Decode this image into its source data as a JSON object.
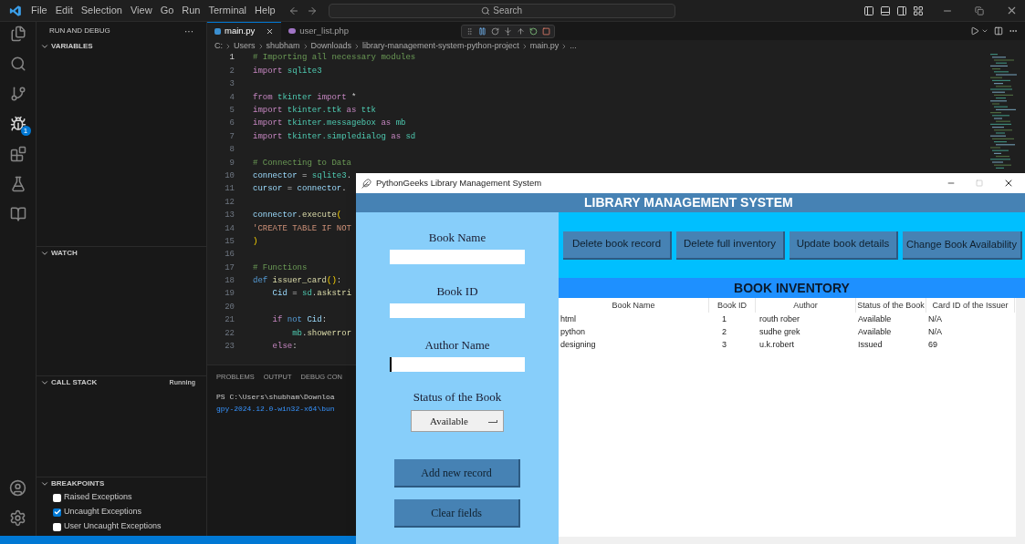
{
  "titlebar": {
    "menu": [
      "File",
      "Edit",
      "Selection",
      "View",
      "Go",
      "Run",
      "Terminal",
      "Help"
    ],
    "search": {
      "placeholder": "Search"
    }
  },
  "activity_bar": {
    "debug_badge": "1"
  },
  "sidebar": {
    "title": "RUN AND DEBUG",
    "more": "···",
    "sections": [
      {
        "title": "VARIABLES"
      },
      {
        "title": "WATCH"
      },
      {
        "title": "CALL STACK",
        "status": "Running"
      },
      {
        "title": "BREAKPOINTS",
        "items": [
          {
            "label": "Raised Exceptions",
            "checked": false
          },
          {
            "label": "Uncaught Exceptions",
            "checked": true
          },
          {
            "label": "User Uncaught Exceptions",
            "checked": false
          }
        ]
      }
    ]
  },
  "editor": {
    "tabs": [
      {
        "label": "main.py",
        "kind": "python",
        "selected": true
      },
      {
        "label": "user_list.php",
        "kind": "php",
        "selected": false
      }
    ],
    "breadcrumb": [
      "C:",
      "Users",
      "shubham",
      "Downloads",
      "library-management-system-python-project",
      "main.py",
      "..."
    ],
    "lines": [
      {
        "number": "1",
        "tokens": [
          {
            "kind": "comment",
            "text": "# Importing all necessary modules"
          }
        ]
      },
      {
        "number": "2",
        "tokens": [
          {
            "kind": "keyword",
            "text": "import"
          },
          {
            "kind": "module",
            "text": " sqlite3"
          }
        ]
      },
      {
        "number": "3"
      },
      {
        "number": "4",
        "tokens": [
          {
            "kind": "keyword",
            "text": "from"
          },
          {
            "kind": "module",
            "text": " tkinter"
          },
          {
            "kind": "keyword",
            "text": " import"
          },
          {
            "kind": "plain",
            "text": " *"
          }
        ]
      },
      {
        "number": "5",
        "tokens": [
          {
            "kind": "keyword",
            "text": "import"
          },
          {
            "kind": "module",
            "text": " tkinter.ttk"
          },
          {
            "kind": "keyword",
            "text": " as"
          },
          {
            "kind": "module",
            "text": " ttk"
          }
        ]
      },
      {
        "number": "6",
        "tokens": [
          {
            "kind": "keyword",
            "text": "import"
          },
          {
            "kind": "module",
            "text": " tkinter.messagebox"
          },
          {
            "kind": "keyword",
            "text": " as"
          },
          {
            "kind": "module",
            "text": " mb"
          }
        ]
      },
      {
        "number": "7",
        "tokens": [
          {
            "kind": "keyword",
            "text": "import"
          },
          {
            "kind": "module",
            "text": " tkinter.simpledialog"
          },
          {
            "kind": "keyword",
            "text": " as"
          },
          {
            "kind": "module",
            "text": " sd"
          }
        ]
      },
      {
        "number": "8"
      },
      {
        "number": "9",
        "tokens": [
          {
            "kind": "comment",
            "text": "# Connecting to Data"
          }
        ]
      },
      {
        "number": "10",
        "tokens": [
          {
            "kind": "variable",
            "text": "connector"
          },
          {
            "kind": "plain",
            "text": " = "
          },
          {
            "kind": "module",
            "text": "sqlite3"
          },
          {
            "kind": "plain",
            "text": "."
          }
        ]
      },
      {
        "number": "11",
        "tokens": [
          {
            "kind": "variable",
            "text": "cursor"
          },
          {
            "kind": "plain",
            "text": " = "
          },
          {
            "kind": "variable",
            "text": "connector"
          },
          {
            "kind": "plain",
            "text": "."
          }
        ]
      },
      {
        "number": "12"
      },
      {
        "number": "13",
        "tokens": [
          {
            "kind": "variable",
            "text": "connector"
          },
          {
            "kind": "plain",
            "text": "."
          },
          {
            "kind": "function",
            "text": "execute"
          },
          {
            "kind": "bracket",
            "text": "("
          }
        ]
      },
      {
        "number": "14",
        "tokens": [
          {
            "kind": "string",
            "text": "'CREATE TABLE IF NOT"
          }
        ]
      },
      {
        "number": "15",
        "tokens": [
          {
            "kind": "bracket",
            "text": ")"
          }
        ]
      },
      {
        "number": "16"
      },
      {
        "number": "17",
        "tokens": [
          {
            "kind": "comment",
            "text": "# Functions"
          }
        ]
      },
      {
        "number": "18",
        "tokens": [
          {
            "kind": "storage",
            "text": "def"
          },
          {
            "kind": "function",
            "text": " issuer_card"
          },
          {
            "kind": "bracket",
            "text": "()"
          },
          {
            "kind": "plain",
            "text": ":"
          }
        ]
      },
      {
        "number": "19",
        "tokens": [
          {
            "kind": "variable",
            "text": "    Cid"
          },
          {
            "kind": "plain",
            "text": " = "
          },
          {
            "kind": "module",
            "text": "sd"
          },
          {
            "kind": "plain",
            "text": "."
          },
          {
            "kind": "function",
            "text": "askstri"
          }
        ]
      },
      {
        "number": "20"
      },
      {
        "number": "21",
        "tokens": [
          {
            "kind": "keyword",
            "text": "    if"
          },
          {
            "kind": "storage",
            "text": " not"
          },
          {
            "kind": "variable",
            "text": " Cid"
          },
          {
            "kind": "plain",
            "text": ":"
          }
        ]
      },
      {
        "number": "22",
        "tokens": [
          {
            "kind": "module",
            "text": "        mb"
          },
          {
            "kind": "plain",
            "text": "."
          },
          {
            "kind": "function",
            "text": "showerror"
          }
        ]
      },
      {
        "number": "23",
        "tokens": [
          {
            "kind": "keyword",
            "text": "    else"
          },
          {
            "kind": "plain",
            "text": ":"
          }
        ]
      }
    ]
  },
  "panel": {
    "tabs": [
      "PROBLEMS",
      "OUTPUT",
      "DEBUG CON"
    ],
    "terminal": [
      "PS C:\\Users\\shubham\\Downloa",
      "gpy-2024.12.0-win32-x64\\bun"
    ]
  },
  "app": {
    "title": "PythonGeeks Library Management System",
    "heading": "LIBRARY MANAGEMENT SYSTEM",
    "fields": [
      {
        "label": "Book Name",
        "focused": false
      },
      {
        "label": "Book ID",
        "focused": false
      },
      {
        "label": "Author Name",
        "focused": true
      }
    ],
    "status": {
      "label": "Status of the Book",
      "value": "Available"
    },
    "form_buttons": [
      "Add new record",
      "Clear fields"
    ],
    "actions": [
      "Delete book record",
      "Delete full inventory",
      "Update book details",
      "Change Book Availability"
    ],
    "inventory": {
      "title": "BOOK INVENTORY",
      "columns": [
        "Book Name",
        "Book ID",
        "Author",
        "Status of the Book",
        "Card ID of the Issuer"
      ],
      "rows": [
        [
          "html",
          "1",
          "routh rober",
          "Available",
          "N/A"
        ],
        [
          "python",
          "2",
          "sudhe grek",
          "Available",
          "N/A"
        ],
        [
          "designing",
          "3",
          "u.k.robert",
          "Issued",
          "69"
        ]
      ]
    }
  }
}
